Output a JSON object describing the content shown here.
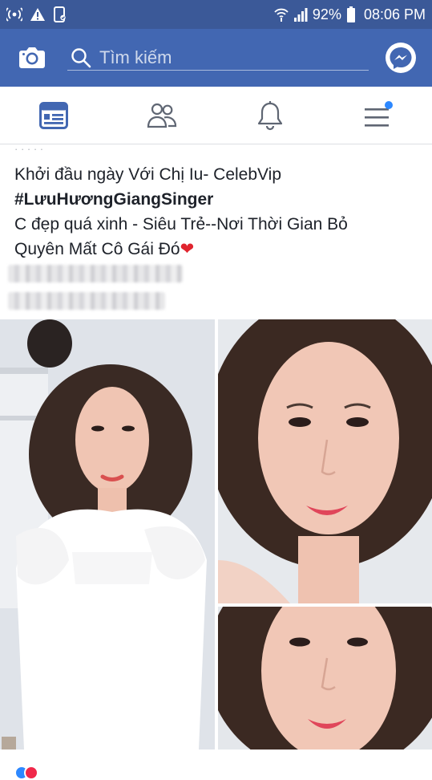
{
  "status_bar": {
    "icons": [
      "wifi-calling-icon",
      "warning-icon",
      "screenshot-icon",
      "hotspot-icon",
      "signal-icon",
      "battery-icon"
    ],
    "battery": "92%",
    "time": "08:06 PM"
  },
  "app_bar": {
    "search_placeholder": "Tìm kiếm",
    "colors": {
      "header": "#4267b2",
      "status": "#3b5998"
    }
  },
  "tabs": [
    {
      "name": "news-feed",
      "icon": "news-feed-icon",
      "active": true
    },
    {
      "name": "friends",
      "icon": "friends-icon",
      "active": false
    },
    {
      "name": "notifications",
      "icon": "bell-icon",
      "active": false
    },
    {
      "name": "menu",
      "icon": "menu-icon",
      "active": false,
      "badge": true
    }
  ],
  "post": {
    "line1": "Khởi đầu ngày Với Chị Iu- CelebVip",
    "hashtag": "#LưuHươngGiangSinger",
    "line3": "C đẹp quá xinh - Siêu Trẻ--Nơi Thời Gian Bỏ",
    "line4": "Quyên Mất Cô Gái Đó",
    "emoji": "❤"
  }
}
